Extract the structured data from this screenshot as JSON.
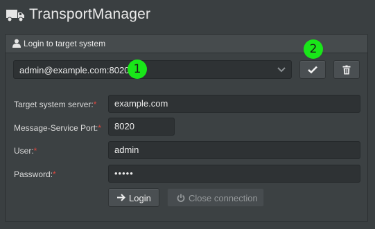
{
  "app": {
    "title": "TransportManager",
    "icon": "truck-icon"
  },
  "login_panel": {
    "heading": "Login to target system",
    "heading_icon": "user-icon",
    "connection_select": {
      "selected": "admin@example.com:8020"
    },
    "confirm_button_icon": "checkmark-icon",
    "delete_button_icon": "trash-icon",
    "fields": {
      "server": {
        "label": "Target system server:",
        "required_mark": "*",
        "value": "example.com"
      },
      "port": {
        "label": "Message-Service Port:",
        "required_mark": "*",
        "value": "8020"
      },
      "user": {
        "label": "User:",
        "required_mark": "*",
        "value": "admin"
      },
      "password": {
        "label": "Password:",
        "required_mark": "*",
        "value": "•••••"
      }
    },
    "login_button": {
      "label": "Login",
      "icon": "arrow-right-icon"
    },
    "close_button": {
      "label": "Close connection",
      "icon": "power-icon",
      "disabled": true
    }
  },
  "annotations": {
    "marker_1": "1",
    "marker_2": "2"
  },
  "colors": {
    "background": "#3a3f41",
    "panel": "#3c4143",
    "input": "#2e3234",
    "required": "#e0463e",
    "marker": "#19e619"
  }
}
